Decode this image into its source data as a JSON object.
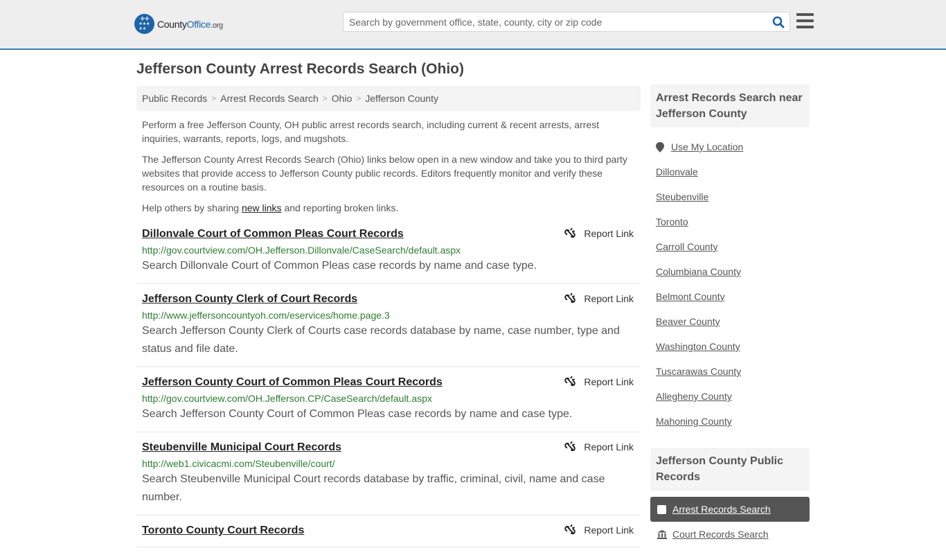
{
  "header": {
    "logo": {
      "name_part1": "County",
      "name_part2": "Office",
      "name_suffix": ".org"
    },
    "search": {
      "placeholder": "Search by government office, state, county, city or zip code",
      "value": ""
    },
    "colors": {
      "brand": "#1d63a8",
      "accent_border": "#3a7db3",
      "url_green": "#2e7d32"
    }
  },
  "page": {
    "title": "Jefferson County Arrest Records Search (Ohio)"
  },
  "breadcrumb": [
    {
      "label": "Public Records"
    },
    {
      "label": "Arrest Records Search"
    },
    {
      "label": "Ohio"
    },
    {
      "label": "Jefferson County"
    }
  ],
  "breadcrumb_separator": ">",
  "intro": {
    "p1": "Perform a free Jefferson County, OH public arrest records search, including current & recent arrests, arrest inquiries, warrants, reports, logs, and mugshots.",
    "p2": "The Jefferson County Arrest Records Search (Ohio) links below open in a new window and take you to third party websites that provide access to Jefferson County public records. Editors frequently monitor and verify these resources on a routine basis.",
    "p3_before": "Help others by sharing ",
    "p3_link": "new links",
    "p3_after": " and reporting broken links."
  },
  "report_label": "Report Link",
  "records": [
    {
      "title": "Dillonvale Court of Common Pleas Court Records",
      "url": "http://gov.courtview.com/OH.Jefferson.Dillonvale/CaseSearch/default.aspx",
      "description": "Search Dillonvale Court of Common Pleas case records by name and case type."
    },
    {
      "title": "Jefferson County Clerk of Court Records",
      "url": "http://www.jeffersoncountyoh.com/eservices/home.page.3",
      "description": "Search Jefferson County Clerk of Courts case records database by name, case number, type and status and file date."
    },
    {
      "title": "Jefferson County Court of Common Pleas Court Records",
      "url": "http://gov.courtview.com/OH.Jefferson.CP/CaseSearch/default.aspx",
      "description": "Search Jefferson County Court of Common Pleas case records by name and case type."
    },
    {
      "title": "Steubenville Municipal Court Records",
      "url": "http://web1.civicacmi.com/Steubenville/court/",
      "description": "Search Steubenville Municipal Court records database by traffic, criminal, civil, name and case number."
    },
    {
      "title": "Toronto County Court Records",
      "url": "",
      "description": ""
    }
  ],
  "sidebar": {
    "nearby_heading": "Arrest Records Search near Jefferson County",
    "use_location": "Use My Location",
    "nearby": [
      "Dillonvale",
      "Steubenville",
      "Toronto",
      "Carroll County",
      "Columbiana County",
      "Belmont County",
      "Beaver County",
      "Washington County",
      "Tuscarawas County",
      "Allegheny County",
      "Mahoning County"
    ],
    "public_records_heading": "Jefferson County Public Records",
    "public_records": [
      {
        "label": "Arrest Records Search",
        "active": true,
        "icon": "checkbox-icon"
      },
      {
        "label": "Court Records Search",
        "active": false,
        "icon": "courthouse-icon"
      }
    ]
  }
}
